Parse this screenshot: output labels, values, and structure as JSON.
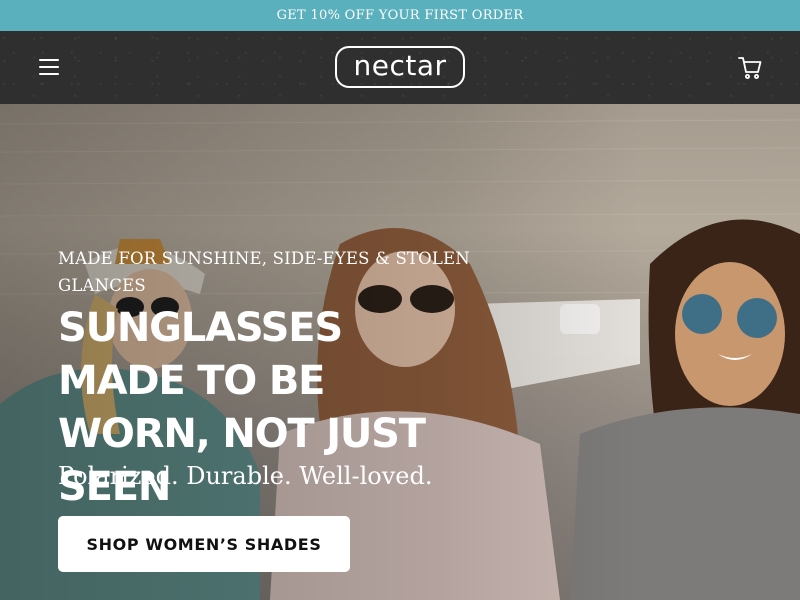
{
  "promo": {
    "text": "GET 10% OFF YOUR FIRST ORDER"
  },
  "header": {
    "logo_text": "nectar",
    "menu_icon": "hamburger-menu-icon",
    "cart_icon": "shopping-cart-icon"
  },
  "hero": {
    "eyebrow": "MADE FOR SUNSHINE, SIDE-EYES & STOLEN GLANCES",
    "headline": "SUNGLASSES MADE TO BE WORN, NOT JUST SEEN",
    "subhead": "Polarized. Durable. Well-loved.",
    "cta_label": "SHOP WOMEN’S SHADES"
  },
  "colors": {
    "promo_bg": "#5bb0bd",
    "header_bg": "#2f2f2f",
    "cta_bg": "#ffffff",
    "cta_text": "#111111"
  }
}
